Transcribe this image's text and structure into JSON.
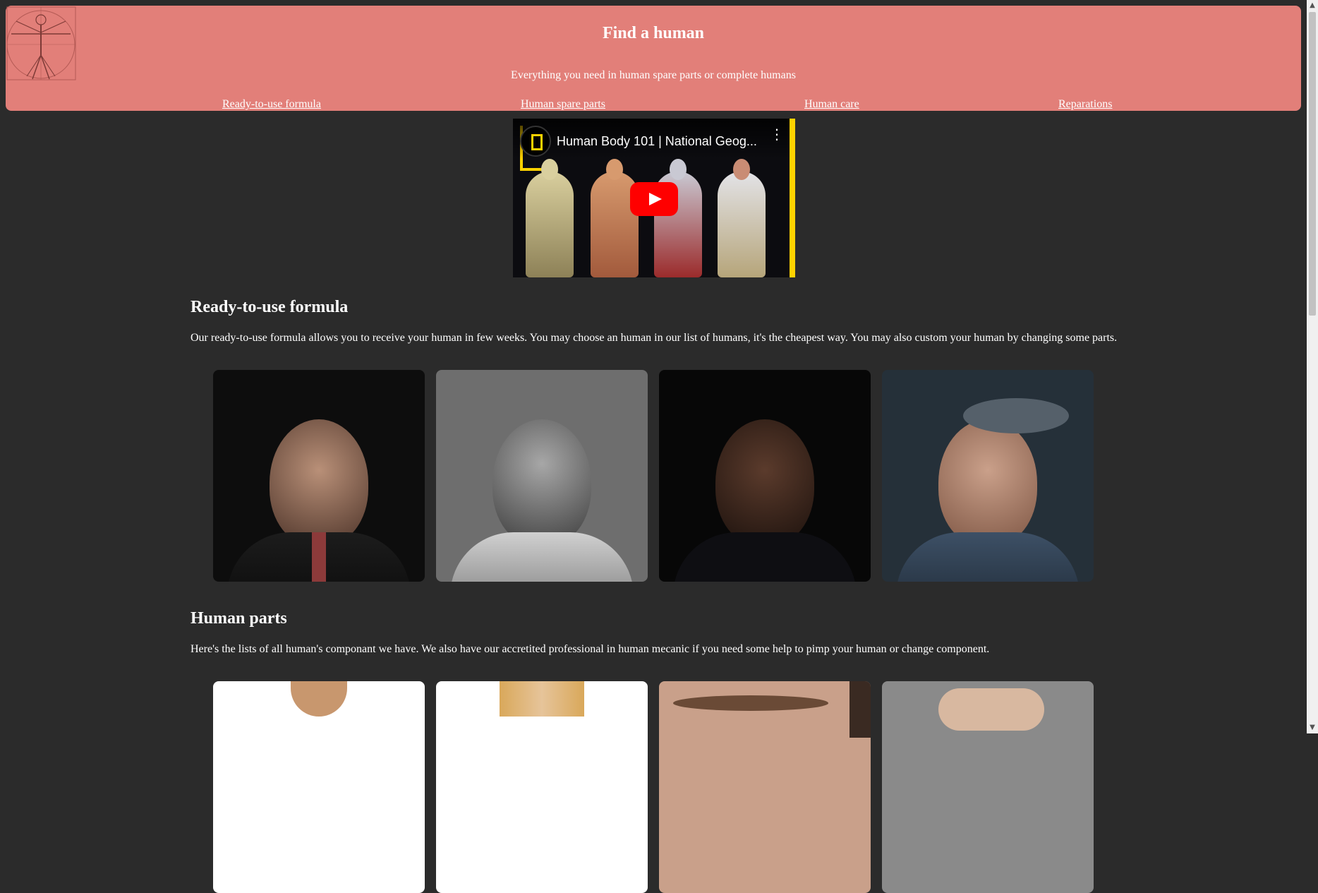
{
  "header": {
    "title": "Find a human",
    "subtitle": "Everything you need in human spare parts or complete humans",
    "nav": [
      {
        "label": "Ready-to-use formula"
      },
      {
        "label": "Human spare parts"
      },
      {
        "label": "Human care"
      },
      {
        "label": "Reparations"
      }
    ]
  },
  "video": {
    "title": "Human Body 101 | National Geog...",
    "channel_icon": "national-geographic-icon",
    "play_icon": "play-icon",
    "menu_icon": "more-vertical-icon"
  },
  "sections": [
    {
      "heading": "Ready-to-use formula",
      "text": "Our ready-to-use formula allows you to receive your human in few weeks. You may choose an human in our list of humans, it's the cheapest way. You may also custom your human by changing some parts."
    },
    {
      "heading": "Human parts",
      "text": "Here's the lists of all human's componant we have. We also have our accretited professional in human mecanic if you need some help to pimp your human or change component."
    }
  ],
  "colors": {
    "header_bg": "#e27f79",
    "page_bg": "#2b2b2b",
    "accent_yellow": "#ffd200",
    "play_red": "#ff0000"
  }
}
